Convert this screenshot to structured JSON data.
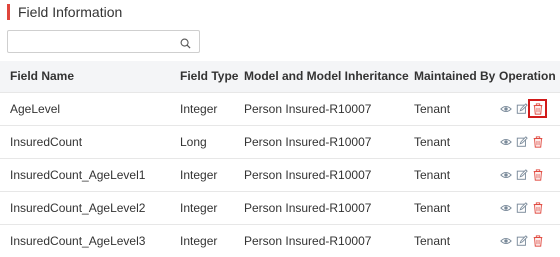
{
  "section": {
    "title": "Field Information"
  },
  "search": {
    "value": "",
    "placeholder": ""
  },
  "table": {
    "headers": {
      "field_name": "Field Name",
      "field_type": "Field Type",
      "model": "Model and Model Inheritance",
      "maintained_by": "Maintained By",
      "operation": "Operation"
    },
    "rows": [
      {
        "field_name": "AgeLevel",
        "field_type": "Integer",
        "model": "Person Insured-R10007",
        "maintained_by": "Tenant"
      },
      {
        "field_name": "InsuredCount",
        "field_type": "Long",
        "model": "Person Insured-R10007",
        "maintained_by": "Tenant"
      },
      {
        "field_name": "InsuredCount_AgeLevel1",
        "field_type": "Integer",
        "model": "Person Insured-R10007",
        "maintained_by": "Tenant"
      },
      {
        "field_name": "InsuredCount_AgeLevel2",
        "field_type": "Integer",
        "model": "Person Insured-R10007",
        "maintained_by": "Tenant"
      },
      {
        "field_name": "InsuredCount_AgeLevel3",
        "field_type": "Integer",
        "model": "Person Insured-R10007",
        "maintained_by": "Tenant"
      }
    ]
  },
  "icons": {
    "view": "eye-icon",
    "edit": "edit-icon",
    "delete": "trash-icon",
    "search": "search-icon"
  },
  "colors": {
    "accent": "#e0463c",
    "icon_gray": "#7a8a9a",
    "delete_red": "#e0463c"
  }
}
